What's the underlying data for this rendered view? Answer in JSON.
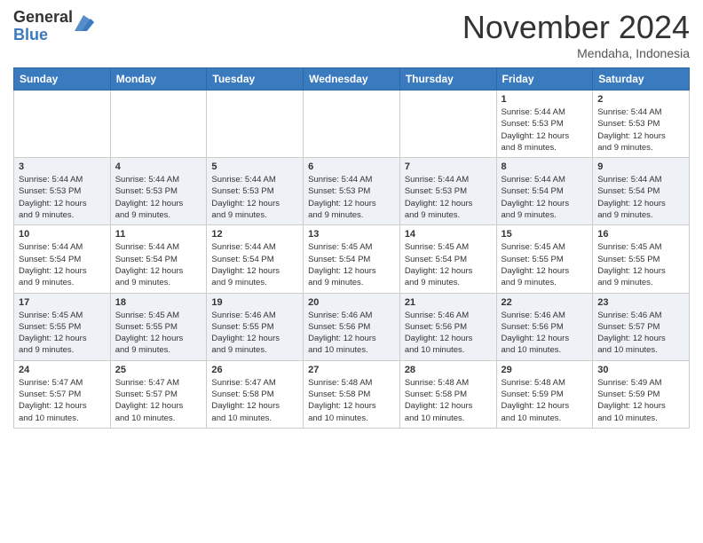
{
  "header": {
    "logo_general": "General",
    "logo_blue": "Blue",
    "month_title": "November 2024",
    "location": "Mendaha, Indonesia"
  },
  "weekdays": [
    "Sunday",
    "Monday",
    "Tuesday",
    "Wednesday",
    "Thursday",
    "Friday",
    "Saturday"
  ],
  "weeks": [
    [
      {
        "day": "",
        "info": ""
      },
      {
        "day": "",
        "info": ""
      },
      {
        "day": "",
        "info": ""
      },
      {
        "day": "",
        "info": ""
      },
      {
        "day": "",
        "info": ""
      },
      {
        "day": "1",
        "info": "Sunrise: 5:44 AM\nSunset: 5:53 PM\nDaylight: 12 hours\nand 8 minutes."
      },
      {
        "day": "2",
        "info": "Sunrise: 5:44 AM\nSunset: 5:53 PM\nDaylight: 12 hours\nand 9 minutes."
      }
    ],
    [
      {
        "day": "3",
        "info": "Sunrise: 5:44 AM\nSunset: 5:53 PM\nDaylight: 12 hours\nand 9 minutes."
      },
      {
        "day": "4",
        "info": "Sunrise: 5:44 AM\nSunset: 5:53 PM\nDaylight: 12 hours\nand 9 minutes."
      },
      {
        "day": "5",
        "info": "Sunrise: 5:44 AM\nSunset: 5:53 PM\nDaylight: 12 hours\nand 9 minutes."
      },
      {
        "day": "6",
        "info": "Sunrise: 5:44 AM\nSunset: 5:53 PM\nDaylight: 12 hours\nand 9 minutes."
      },
      {
        "day": "7",
        "info": "Sunrise: 5:44 AM\nSunset: 5:53 PM\nDaylight: 12 hours\nand 9 minutes."
      },
      {
        "day": "8",
        "info": "Sunrise: 5:44 AM\nSunset: 5:54 PM\nDaylight: 12 hours\nand 9 minutes."
      },
      {
        "day": "9",
        "info": "Sunrise: 5:44 AM\nSunset: 5:54 PM\nDaylight: 12 hours\nand 9 minutes."
      }
    ],
    [
      {
        "day": "10",
        "info": "Sunrise: 5:44 AM\nSunset: 5:54 PM\nDaylight: 12 hours\nand 9 minutes."
      },
      {
        "day": "11",
        "info": "Sunrise: 5:44 AM\nSunset: 5:54 PM\nDaylight: 12 hours\nand 9 minutes."
      },
      {
        "day": "12",
        "info": "Sunrise: 5:44 AM\nSunset: 5:54 PM\nDaylight: 12 hours\nand 9 minutes."
      },
      {
        "day": "13",
        "info": "Sunrise: 5:45 AM\nSunset: 5:54 PM\nDaylight: 12 hours\nand 9 minutes."
      },
      {
        "day": "14",
        "info": "Sunrise: 5:45 AM\nSunset: 5:54 PM\nDaylight: 12 hours\nand 9 minutes."
      },
      {
        "day": "15",
        "info": "Sunrise: 5:45 AM\nSunset: 5:55 PM\nDaylight: 12 hours\nand 9 minutes."
      },
      {
        "day": "16",
        "info": "Sunrise: 5:45 AM\nSunset: 5:55 PM\nDaylight: 12 hours\nand 9 minutes."
      }
    ],
    [
      {
        "day": "17",
        "info": "Sunrise: 5:45 AM\nSunset: 5:55 PM\nDaylight: 12 hours\nand 9 minutes."
      },
      {
        "day": "18",
        "info": "Sunrise: 5:45 AM\nSunset: 5:55 PM\nDaylight: 12 hours\nand 9 minutes."
      },
      {
        "day": "19",
        "info": "Sunrise: 5:46 AM\nSunset: 5:55 PM\nDaylight: 12 hours\nand 9 minutes."
      },
      {
        "day": "20",
        "info": "Sunrise: 5:46 AM\nSunset: 5:56 PM\nDaylight: 12 hours\nand 10 minutes."
      },
      {
        "day": "21",
        "info": "Sunrise: 5:46 AM\nSunset: 5:56 PM\nDaylight: 12 hours\nand 10 minutes."
      },
      {
        "day": "22",
        "info": "Sunrise: 5:46 AM\nSunset: 5:56 PM\nDaylight: 12 hours\nand 10 minutes."
      },
      {
        "day": "23",
        "info": "Sunrise: 5:46 AM\nSunset: 5:57 PM\nDaylight: 12 hours\nand 10 minutes."
      }
    ],
    [
      {
        "day": "24",
        "info": "Sunrise: 5:47 AM\nSunset: 5:57 PM\nDaylight: 12 hours\nand 10 minutes."
      },
      {
        "day": "25",
        "info": "Sunrise: 5:47 AM\nSunset: 5:57 PM\nDaylight: 12 hours\nand 10 minutes."
      },
      {
        "day": "26",
        "info": "Sunrise: 5:47 AM\nSunset: 5:58 PM\nDaylight: 12 hours\nand 10 minutes."
      },
      {
        "day": "27",
        "info": "Sunrise: 5:48 AM\nSunset: 5:58 PM\nDaylight: 12 hours\nand 10 minutes."
      },
      {
        "day": "28",
        "info": "Sunrise: 5:48 AM\nSunset: 5:58 PM\nDaylight: 12 hours\nand 10 minutes."
      },
      {
        "day": "29",
        "info": "Sunrise: 5:48 AM\nSunset: 5:59 PM\nDaylight: 12 hours\nand 10 minutes."
      },
      {
        "day": "30",
        "info": "Sunrise: 5:49 AM\nSunset: 5:59 PM\nDaylight: 12 hours\nand 10 minutes."
      }
    ]
  ]
}
